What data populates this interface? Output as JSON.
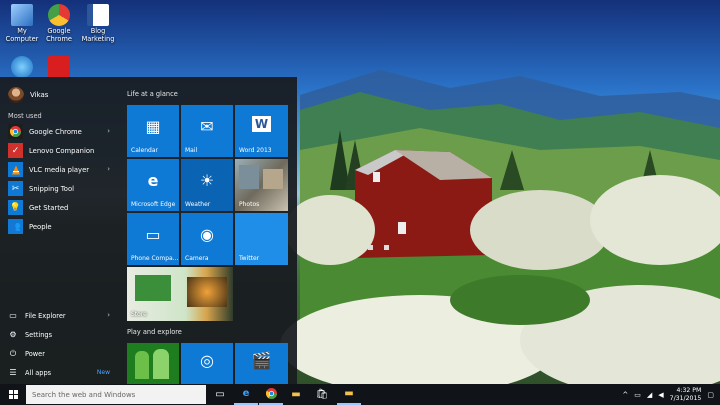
{
  "desktop_icons": [
    {
      "name": "my-computer-desktop-icon",
      "label": "My Computer",
      "color": "#6aa9e8"
    },
    {
      "name": "google-chrome-desktop-icon",
      "label": "Google Chrome",
      "color": "#e53935"
    },
    {
      "name": "blog-marketing-desktop-icon",
      "label": "Blog Marketing",
      "color": "#2b579a"
    }
  ],
  "start_menu": {
    "user_name": "Vikas",
    "most_used_label": "Most used",
    "most_used": [
      {
        "label": "Google Chrome",
        "icon": "chrome-icon",
        "has_arrow": true
      },
      {
        "label": "Lenovo Companion",
        "icon": "lenovo-companion-icon",
        "has_arrow": false
      },
      {
        "label": "VLC media player",
        "icon": "vlc-icon",
        "has_arrow": true
      },
      {
        "label": "Snipping Tool",
        "icon": "snipping-tool-icon",
        "has_arrow": false
      },
      {
        "label": "Get Started",
        "icon": "get-started-icon",
        "has_arrow": false
      },
      {
        "label": "People",
        "icon": "people-icon",
        "has_arrow": false
      }
    ],
    "bottom": {
      "file_explorer": "File Explorer",
      "settings": "Settings",
      "power": "Power",
      "all_apps": "All apps",
      "new_badge": "New"
    },
    "groups": {
      "life_at_a_glance": "Life at a glance",
      "play_and_explore": "Play and explore"
    },
    "tiles": {
      "calendar": "Calendar",
      "mail": "Mail",
      "word": "Word 2013",
      "edge": "Microsoft Edge",
      "weather": "Weather",
      "photos": "Photos",
      "phone": "Phone Compa...",
      "camera": "Camera",
      "twitter": "Twitter",
      "store": "Store"
    }
  },
  "taskbar": {
    "search_placeholder": "Search the web and Windows",
    "time": "4:32 PM",
    "date": "7/31/2015"
  },
  "colors": {
    "tile_blue": "#0e7ad6",
    "tile_dark_blue": "#0a63b3",
    "menu_bg": "#181c20",
    "taskbar_bg": "#101418"
  }
}
